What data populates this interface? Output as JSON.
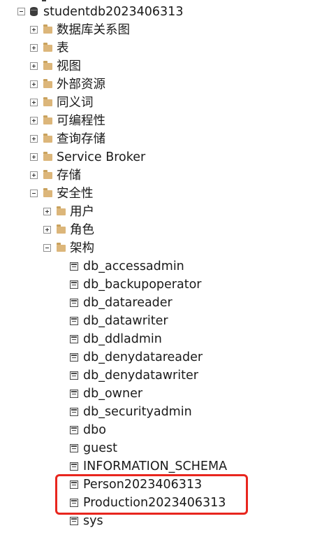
{
  "tree": {
    "database": "studentdb2023406313",
    "top_folders": [
      "数据库关系图",
      "表",
      "视图",
      "外部资源",
      "同义词",
      "可编程性",
      "查询存储",
      "Service Broker",
      "存储"
    ],
    "security": {
      "label": "安全性",
      "children": [
        "用户",
        "角色"
      ],
      "schemas_folder": "架构",
      "schemas": [
        "db_accessadmin",
        "db_backupoperator",
        "db_datareader",
        "db_datawriter",
        "db_ddladmin",
        "db_denydatareader",
        "db_denydatawriter",
        "db_owner",
        "db_securityadmin",
        "dbo",
        "guest",
        "INFORMATION_SCHEMA",
        "Person2023406313",
        "Production2023406313",
        "sys"
      ]
    }
  },
  "highlight": {
    "color": "#e8261e",
    "items": [
      "Person2023406313",
      "Production2023406313"
    ]
  }
}
